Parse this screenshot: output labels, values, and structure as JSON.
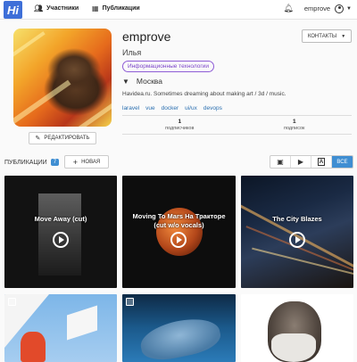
{
  "nav": {
    "logo_text": "Hi",
    "participants": "Участники",
    "publications": "Публикации",
    "username": "emprove"
  },
  "profile": {
    "username": "emprove",
    "real_name": "Илья",
    "contacts_button": "КОНТАКТЫ",
    "tag": "Информационные технологии",
    "location": "Москва",
    "bio": "Havidea.ru. Sometimes dreaming about making art / 3d / music.",
    "skills": [
      "laravel",
      "vue",
      "docker",
      "ui/ux",
      "devops"
    ],
    "stats": [
      {
        "value": "1",
        "label": "подписчиков"
      },
      {
        "value": "1",
        "label": "подписок"
      }
    ],
    "edit_button": "РЕДАКТИРОВАТЬ"
  },
  "publications_bar": {
    "label": "ПУБЛИКАЦИИ",
    "count": "7",
    "new_button": "НОВАЯ",
    "filters": [
      "image",
      "video",
      "text",
      "ВСЕ"
    ],
    "active_filter": "ВСЕ"
  },
  "cards": [
    {
      "title": "Move Away (cut)",
      "type": "video"
    },
    {
      "title": "Moving To Mars На Тракторе (cut w/o vocals)",
      "type": "video"
    },
    {
      "title": "The City Blazes",
      "type": "video"
    },
    {
      "title": "",
      "type": "image"
    },
    {
      "title": "",
      "type": "image"
    },
    {
      "title": "",
      "type": "image"
    }
  ],
  "colors": {
    "accent": "#3f8ed2",
    "tag": "#7b43c9",
    "link": "#2a6fb0",
    "logo": "#3e6fd8"
  }
}
